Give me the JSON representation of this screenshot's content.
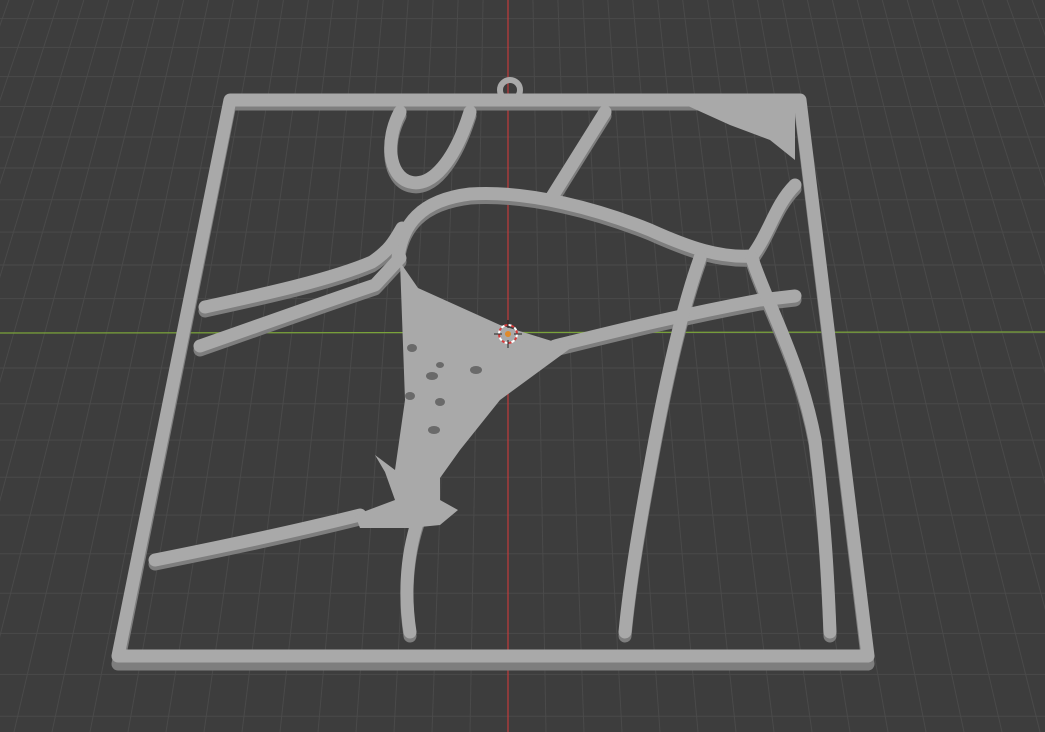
{
  "viewport": {
    "background_color": "#3d3d3d",
    "grid_color": "#4a4a4a",
    "x_axis_color": "#7aa33a",
    "y_axis_color": "#c23b3b",
    "model_color": "#a9a9a9",
    "model_shadow_color": "#7e7e7e"
  },
  "cursor": {
    "icon": "3d-cursor-icon"
  }
}
